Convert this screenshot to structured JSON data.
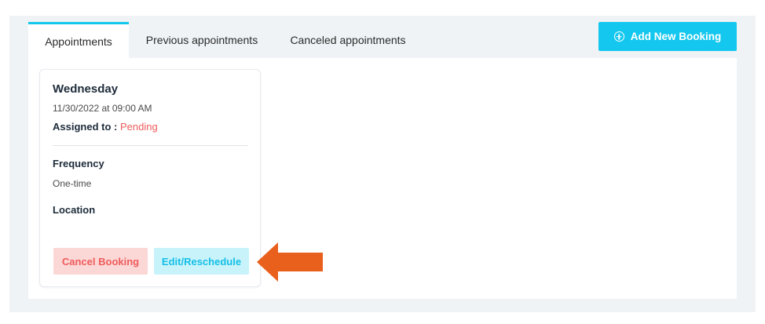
{
  "tabs": [
    {
      "label": "Appointments",
      "active": true
    },
    {
      "label": "Previous appointments",
      "active": false
    },
    {
      "label": "Canceled appointments",
      "active": false
    }
  ],
  "add_booking": {
    "label": "Add New Booking",
    "icon": "plus-circle-icon"
  },
  "appointment": {
    "day": "Wednesday",
    "datetime": "11/30/2022 at 09:00 AM",
    "assigned_label": "Assigned to :",
    "assigned_value": "Pending",
    "frequency_label": "Frequency",
    "frequency_value": "One-time",
    "location_label": "Location",
    "cancel_label": "Cancel Booking",
    "edit_label": "Edit/Reschedule"
  },
  "annotation": {
    "icon": "arrow-left-icon",
    "color": "#e8601c"
  },
  "colors": {
    "accent": "#13c7ee",
    "danger": "#ef5c5c",
    "danger_bg": "#fbd7d6",
    "accent_bg": "#c9f3fb",
    "background": "#eff3f6"
  }
}
